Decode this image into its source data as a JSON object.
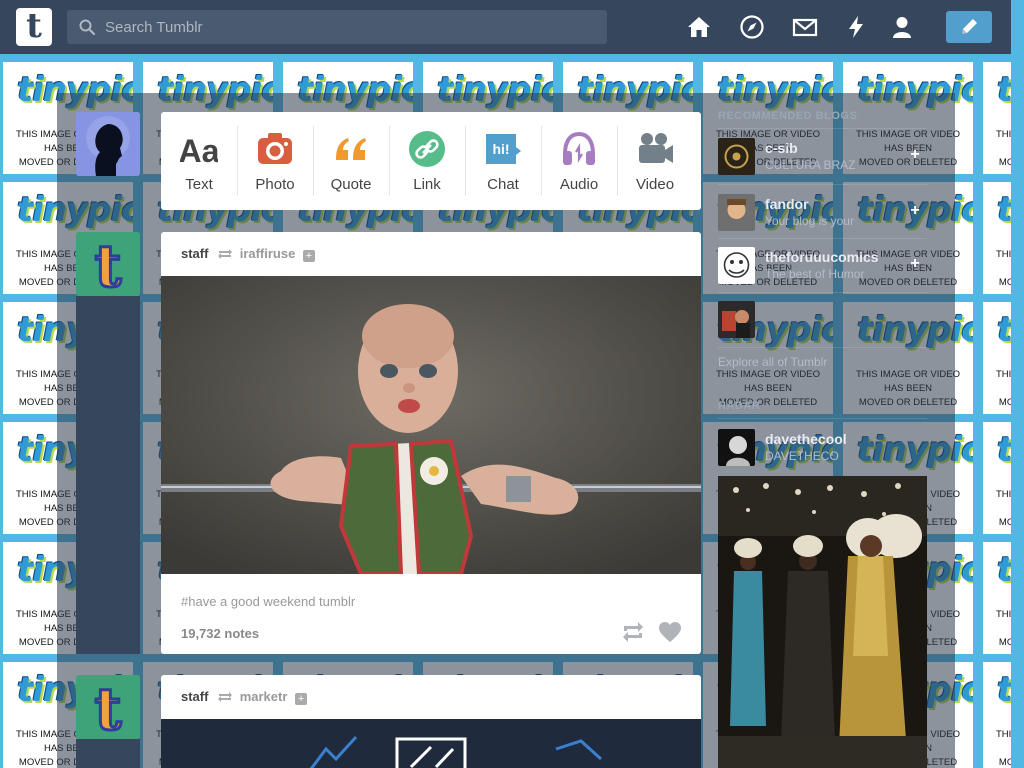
{
  "search": {
    "placeholder": "Search Tumblr"
  },
  "header": {
    "logo_letter": "t",
    "nav": [
      {
        "name": "home-icon",
        "label": "Home"
      },
      {
        "name": "explore-icon",
        "label": "Explore"
      },
      {
        "name": "inbox-icon",
        "label": "Inbox"
      },
      {
        "name": "activity-icon",
        "label": "Activity"
      },
      {
        "name": "account-icon",
        "label": "Account"
      }
    ],
    "compose_icon": "pencil-icon"
  },
  "placeholder_tile": {
    "logo": "tinypic",
    "tm": "™",
    "line1": "THIS IMAGE OR VIDEO",
    "line2": "HAS BEEN",
    "line3": "MOVED OR DELETED"
  },
  "post_types": [
    {
      "label": "Text",
      "icon": "text-icon",
      "color": "#444444"
    },
    {
      "label": "Photo",
      "icon": "camera-icon",
      "color": "#d95e40"
    },
    {
      "label": "Quote",
      "icon": "quote-icon",
      "color": "#f2992e"
    },
    {
      "label": "Link",
      "icon": "link-icon",
      "color": "#56bc8a"
    },
    {
      "label": "Chat",
      "icon": "chat-icon",
      "color": "#529ecc"
    },
    {
      "label": "Audio",
      "icon": "headphones-icon",
      "color": "#a77dc2"
    },
    {
      "label": "Video",
      "icon": "video-camera-icon",
      "color": "#748089"
    }
  ],
  "posts": [
    {
      "author": "staff",
      "source": "iraffiruse",
      "follow": "+",
      "tags": "#have a good weekend tumblr",
      "notes": "19,732 notes"
    },
    {
      "author": "staff",
      "source": "marketr",
      "follow": "+"
    }
  ],
  "sidebar": {
    "recommended_heading": "RECOMMENDED BLOGS",
    "blogs": [
      {
        "name": "c-sib",
        "sub": "CULTURA BRAZ",
        "follow": "+"
      },
      {
        "name": "fandor",
        "sub": "Your blog is your",
        "follow": "+"
      },
      {
        "name": "theforuuucomics",
        "sub": "The best of Humor",
        "follow": "+"
      },
      {
        "name": "",
        "sub": "",
        "follow": ""
      }
    ],
    "explore_link": "Explore all of Tumblr",
    "radar_heading": "RADAR",
    "radar_blog": {
      "name": "davethecool",
      "sub": "DAVETHECO"
    }
  },
  "colors": {
    "header": "#36465d",
    "accent": "#529ecc",
    "page_bg": "#50b8e3"
  }
}
